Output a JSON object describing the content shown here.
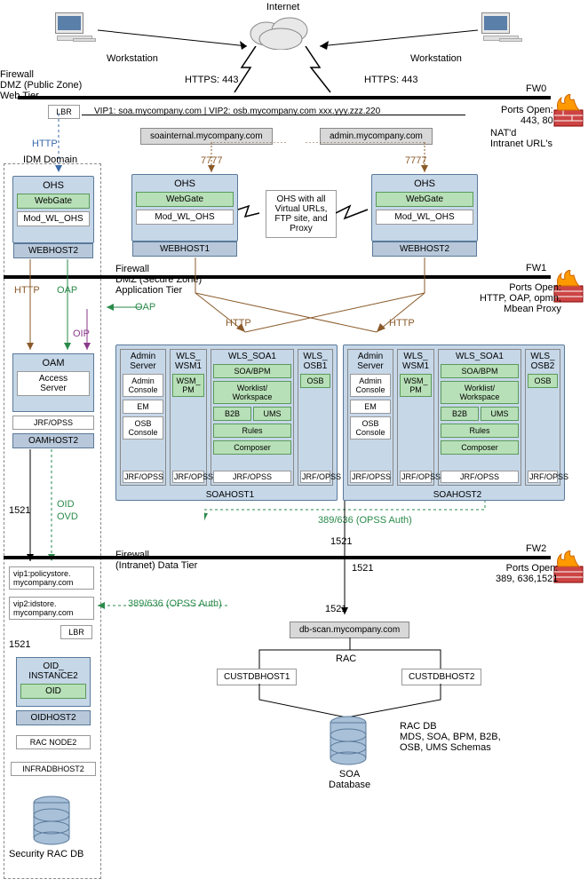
{
  "top": {
    "internet": "Internet",
    "ws_left": "Workstation",
    "ws_right": "Workstation",
    "https_left": "HTTPS: 443",
    "https_right": "HTTPS: 443"
  },
  "firewalls": {
    "fw0": {
      "name": "FW0",
      "zone": "Firewall\nDMZ (Public Zone)\nWeb Tier",
      "ports": "Ports Open:\n443, 80"
    },
    "fw1": {
      "name": "FW1",
      "zone": "Firewall\nDMZ (Secure Zone)\nApplication Tier",
      "ports": "Ports Open:\nHTTP, OAP, opmn,\nMbean Proxy"
    },
    "fw2": {
      "name": "FW2",
      "zone": "Firewall\n(Intranet) Data Tier",
      "ports": "Ports Open:\n389, 636,1521"
    }
  },
  "lbr": {
    "label": "LBR",
    "vip_line": "VIP1: soa.mycompany.com | VIP2: osb.mycompany.com  xxx.yyy.zzz.220",
    "intranet1": "soainternal.mycompany.com",
    "intranet2": "admin.mycompany.com",
    "nat": "NAT'd\nIntranet URL's"
  },
  "ports": {
    "p7777a": "7777",
    "p7777b": "7777",
    "http": "HTTP",
    "oap": "OAP",
    "oip": "OIP",
    "oap2": "OAP",
    "http2": "HTTP",
    "http3": "HTTP",
    "p1521": "1521",
    "p1521b": "1521",
    "p1521c": "1521",
    "p1521d": "1521",
    "opss1": "389/636 (OPSS Auth)",
    "opss2": "389/636 (OPSS Auth)",
    "oid": "OID",
    "ovd": "OVD"
  },
  "idm": {
    "title": "IDM Domain",
    "ohs": {
      "title": "OHS",
      "webgate": "WebGate",
      "mod": "Mod_WL_OHS",
      "host": "WEBHOST2"
    },
    "oam": {
      "title": "OAM",
      "access": "Access\nServer",
      "jrf": "JRF/OPSS",
      "host": "OAMHOST2"
    },
    "vip1": "vip1:policystore.\nmycompany.com",
    "vip2": "vip2:idstore.\nmycompany.com",
    "lbr2": "LBR",
    "oid_inst": {
      "title": "OID_\nINSTANCE2",
      "oid": "OID",
      "host": "OIDHOST2"
    },
    "rac": "RAC NODE2",
    "infra": "INFRADBHOST2",
    "secdb": "Security RAC DB"
  },
  "ohs_note": "OHS with all\nVirtual URLs,\nFTP site, and\nProxy",
  "ohs1": {
    "title": "OHS",
    "webgate": "WebGate",
    "mod": "Mod_WL_OHS",
    "host": "WEBHOST1"
  },
  "ohs2": {
    "title": "OHS",
    "webgate": "WebGate",
    "mod": "Mod_WL_OHS",
    "host": "WEBHOST2"
  },
  "soa1": {
    "host": "SOAHOST1",
    "admin": {
      "title": "Admin\nServer",
      "console": "Admin\nConsole",
      "em": "EM",
      "osb": "OSB\nConsole"
    },
    "wsm": {
      "title": "WLS_\nWSM1",
      "pm": "WSM_\nPM"
    },
    "wls_soa": {
      "title": "WLS_SOA1",
      "soabpm": "SOA/BPM",
      "worklist": "Worklist/\nWorkspace",
      "b2b": "B2B",
      "ums": "UMS",
      "rules": "Rules",
      "composer": "Composer"
    },
    "osb": {
      "title": "WLS_\nOSB1",
      "osb": "OSB"
    },
    "jrf": "JRF/OPSS"
  },
  "soa2": {
    "host": "SOAHOST2",
    "admin": {
      "title": "Admin\nServer",
      "console": "Admin\nConsole",
      "em": "EM",
      "osb": "OSB\nConsole"
    },
    "wsm": {
      "title": "WLS_\nWSM1",
      "pm": "WSM_\nPM"
    },
    "wls_soa": {
      "title": "WLS_SOA1",
      "soabpm": "SOA/BPM",
      "worklist": "Worklist/\nWorkspace",
      "b2b": "B2B",
      "ums": "UMS",
      "rules": "Rules",
      "composer": "Composer"
    },
    "osb": {
      "title": "WLS_\nOSB2",
      "osb": "OSB"
    },
    "jrf": "JRF/OPSS"
  },
  "db": {
    "scan": "db-scan.mycompany.com",
    "rac": "RAC",
    "cust1": "CUSTDBHOST1",
    "cust2": "CUSTDBHOST2",
    "soadb": "SOA\nDatabase",
    "racdb": "RAC DB\nMDS, SOA, BPM, B2B,\nOSB, UMS Schemas"
  }
}
